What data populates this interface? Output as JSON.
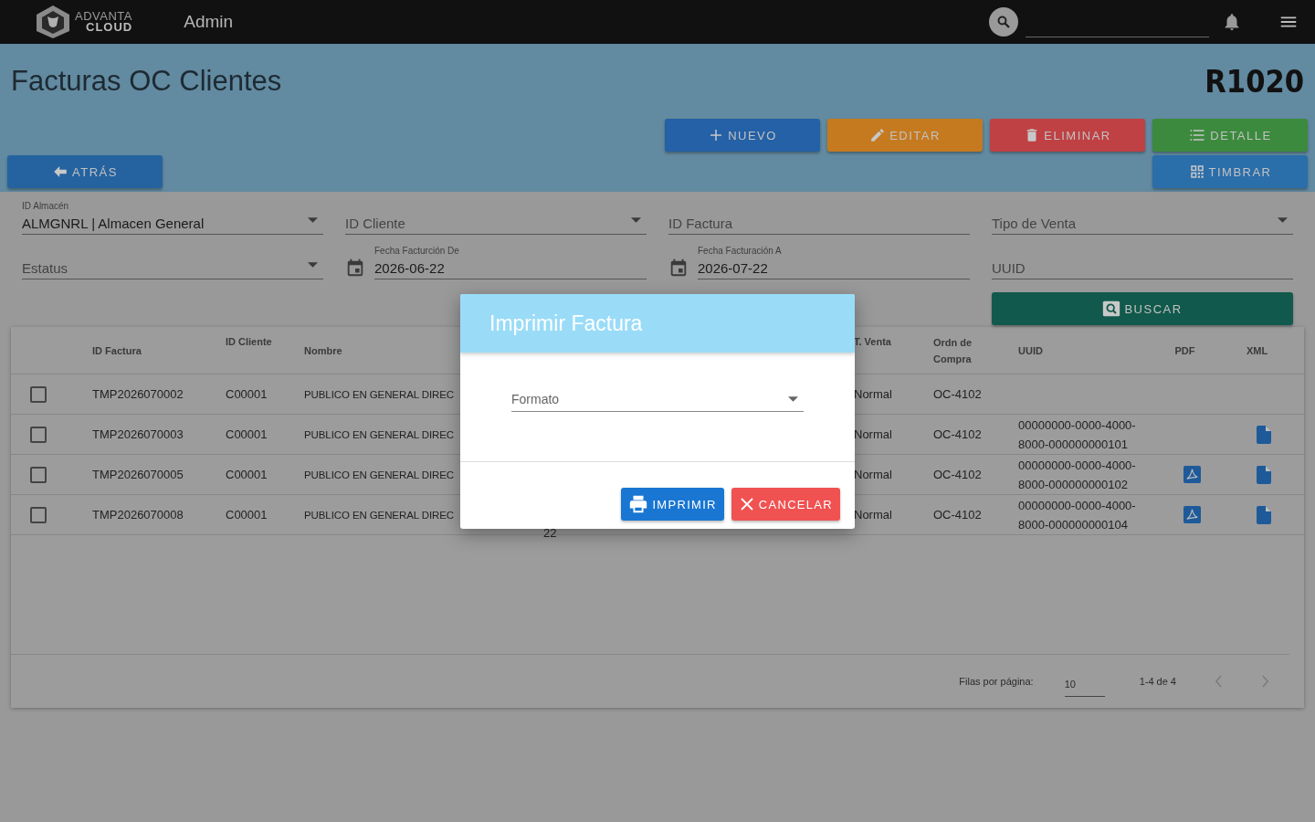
{
  "topbar": {
    "brand_top": "ADVANTA",
    "brand_bottom": "CLOUD",
    "section": "Admin"
  },
  "page": {
    "title": "Facturas OC Clientes",
    "code": "R1020"
  },
  "actions": [
    {
      "label": "NUEVO",
      "kind": "new"
    },
    {
      "label": "EDITAR",
      "kind": "edit"
    },
    {
      "label": "ELIMINAR",
      "kind": "delete"
    },
    {
      "label": "DETALLE",
      "kind": "detail"
    }
  ],
  "back_button": {
    "label": "ATRÁS"
  },
  "stamp_button": {
    "label": "TIMBRAR"
  },
  "filters": [
    {
      "kind": "select",
      "label": "ID Almacén",
      "value": "ALMGNRL | Almacen General"
    },
    {
      "kind": "select",
      "label": "ID Cliente"
    },
    {
      "kind": "text",
      "label": "ID Factura"
    },
    {
      "kind": "select",
      "label": "Tipo de Venta"
    },
    {
      "kind": "select",
      "label": "Estatus"
    },
    {
      "kind": "date",
      "label": "Fecha Facturción De",
      "value": "2026-06-22"
    },
    {
      "kind": "date",
      "label": "Fecha Facturación A",
      "value": "2026-07-22"
    },
    {
      "kind": "text",
      "label": "UUID"
    }
  ],
  "search_button": {
    "label": "BUSCAR"
  },
  "table": {
    "columns": [
      "ID Factura",
      "ID Cliente",
      "Nombre",
      "T. Venta",
      "Ordn de Compra",
      "UUID",
      "PDF",
      "XML"
    ],
    "rows": [
      {
        "checked": false,
        "id_factura": "TMP2026070002",
        "id_cliente": "C00001",
        "nombre": "PUBLICO EN GENERAL DIREC",
        "t_venta": "Normal",
        "orden": "OC-4102",
        "pdf": false,
        "xml": false
      },
      {
        "checked": false,
        "id_factura": "TMP2026070003",
        "id_cliente": "C00001",
        "nombre": "PUBLICO EN GENERAL DIREC",
        "t_venta": "Normal",
        "orden": "OC-4102",
        "uuid": "00000000-0000-4000-8000-000000000101",
        "pdf": false,
        "xml": true
      },
      {
        "checked": false,
        "id_factura": "TMP2026070005",
        "id_cliente": "C00001",
        "nombre": "PUBLICO EN GENERAL DIREC",
        "t_venta": "Normal",
        "orden": "OC-4102",
        "uuid": "00000000-0000-4000-8000-000000000102",
        "pdf": true,
        "xml": true
      },
      {
        "checked": false,
        "id_factura": "TMP2026070008",
        "id_cliente": "C00001",
        "nombre": "PUBLICO EN GENERAL DIREC",
        "column_5": "22",
        "t_venta": "Normal",
        "orden": "OC-4102",
        "uuid": "00000000-0000-4000-8000-000000000104",
        "pdf": true,
        "xml": true
      }
    ],
    "pagination": {
      "rows_label": "Filas por página:",
      "rows_per_page": "10",
      "range": "1-4 de 4"
    }
  },
  "dialog": {
    "title": "Imprimir Factura",
    "field": {
      "label": "Formato"
    },
    "buttons": [
      {
        "label": "IMPRIMIR",
        "kind": "print"
      },
      {
        "label": "CANCELAR",
        "kind": "cancel"
      }
    ]
  }
}
